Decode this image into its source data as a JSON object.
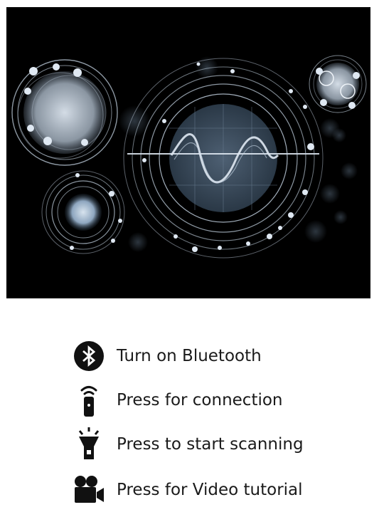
{
  "colors": {
    "accent": "#c9d8e8",
    "background": "#000000",
    "icon": "#111111",
    "text": "#1a1a1a"
  },
  "instructions": [
    {
      "icon": "bluetooth-icon",
      "label": "Turn on Bluetooth"
    },
    {
      "icon": "remote-icon",
      "label": "Press for connection"
    },
    {
      "icon": "flashlight-icon",
      "label": "Press to start scanning"
    },
    {
      "icon": "video-camera-icon",
      "label": "Press for Video tutorial"
    }
  ]
}
